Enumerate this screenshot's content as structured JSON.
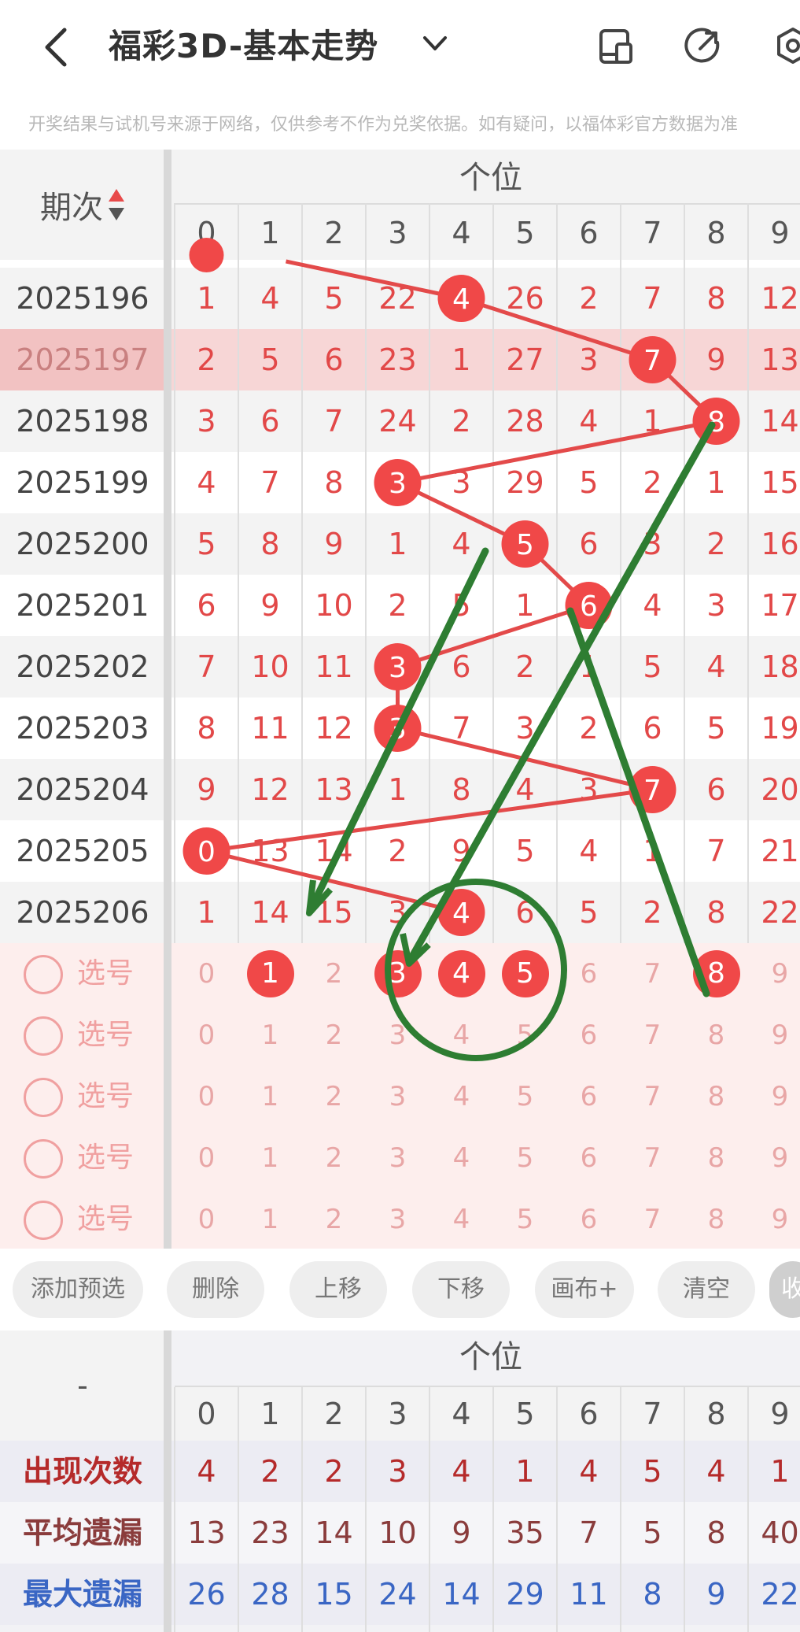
{
  "app": {
    "title": "福彩3D-基本走势",
    "notice": "开奖结果与试机号来源于网络，仅供参考不作为兑奖依据。如有疑问，以福体彩官方数据为准"
  },
  "table": {
    "period_header": "期次",
    "group_label": "个位",
    "columns": [
      "0",
      "1",
      "2",
      "3",
      "4",
      "5",
      "6",
      "7",
      "8",
      "9"
    ],
    "rows": [
      {
        "period": "2025196",
        "cells": [
          "1",
          "4",
          "5",
          "22",
          "4",
          "26",
          "2",
          "7",
          "8",
          "12"
        ],
        "hit": 4
      },
      {
        "period": "2025197",
        "cells": [
          "2",
          "5",
          "6",
          "23",
          "1",
          "27",
          "3",
          "7",
          "9",
          "13"
        ],
        "hit": 7
      },
      {
        "period": "2025198",
        "cells": [
          "3",
          "6",
          "7",
          "24",
          "2",
          "28",
          "4",
          "1",
          "8",
          "14"
        ],
        "hit": 8
      },
      {
        "period": "2025199",
        "cells": [
          "4",
          "7",
          "8",
          "3",
          "3",
          "29",
          "5",
          "2",
          "1",
          "15"
        ],
        "hit": 3
      },
      {
        "period": "2025200",
        "cells": [
          "5",
          "8",
          "9",
          "1",
          "4",
          "5",
          "6",
          "3",
          "2",
          "16"
        ],
        "hit": 5
      },
      {
        "period": "2025201",
        "cells": [
          "6",
          "9",
          "10",
          "2",
          "5",
          "1",
          "6",
          "4",
          "3",
          "17"
        ],
        "hit": 6
      },
      {
        "period": "2025202",
        "cells": [
          "7",
          "10",
          "11",
          "3",
          "6",
          "2",
          "1",
          "5",
          "4",
          "18"
        ],
        "hit": 3
      },
      {
        "period": "2025203",
        "cells": [
          "8",
          "11",
          "12",
          "3",
          "7",
          "3",
          "2",
          "6",
          "5",
          "19"
        ],
        "hit": 3
      },
      {
        "period": "2025204",
        "cells": [
          "9",
          "12",
          "13",
          "1",
          "8",
          "4",
          "3",
          "7",
          "6",
          "20"
        ],
        "hit": 7
      },
      {
        "period": "2025205",
        "cells": [
          "0",
          "13",
          "14",
          "2",
          "9",
          "5",
          "4",
          "1",
          "7",
          "21"
        ],
        "hit": 0
      },
      {
        "period": "2025206",
        "cells": [
          "1",
          "14",
          "15",
          "3",
          "4",
          "6",
          "5",
          "2",
          "8",
          "22"
        ],
        "hit": 4
      }
    ],
    "highlighted_row": "2025197"
  },
  "select_rows": {
    "label": "选号",
    "digits": [
      "0",
      "1",
      "2",
      "3",
      "4",
      "5",
      "6",
      "7",
      "8",
      "9"
    ],
    "rows": [
      {
        "selected": [
          1,
          3,
          4,
          5,
          8
        ]
      },
      {
        "selected": []
      },
      {
        "selected": []
      },
      {
        "selected": []
      },
      {
        "selected": []
      }
    ]
  },
  "buttons": [
    "添加预选",
    "删除",
    "上移",
    "下移",
    "画布+",
    "清空",
    "收"
  ],
  "stats": {
    "corner": "-",
    "group_label": "个位",
    "columns": [
      "0",
      "1",
      "2",
      "3",
      "4",
      "5",
      "6",
      "7",
      "8",
      "9"
    ],
    "rows": [
      {
        "label": "出现次数",
        "values": [
          "4",
          "2",
          "2",
          "3",
          "4",
          "1",
          "4",
          "5",
          "4",
          "1"
        ],
        "color": "#b52a2a"
      },
      {
        "label": "平均遗漏",
        "values": [
          "13",
          "23",
          "14",
          "10",
          "9",
          "35",
          "7",
          "5",
          "8",
          "40"
        ],
        "color": "#8a3c3c"
      },
      {
        "label": "最大遗漏",
        "values": [
          "26",
          "28",
          "15",
          "24",
          "14",
          "29",
          "11",
          "8",
          "9",
          "22"
        ],
        "color": "#3a66c4"
      }
    ]
  },
  "colors": {
    "hit": "#f04848",
    "trend_line": "#e34a4a",
    "annotation": "#2e7d32",
    "highlight_row": "#f7d6d6",
    "select_bg": "#fdeeed"
  },
  "icons": [
    "back-icon",
    "chevron-down-icon",
    "device-icon",
    "share-icon",
    "settings-icon",
    "sort-icon"
  ]
}
